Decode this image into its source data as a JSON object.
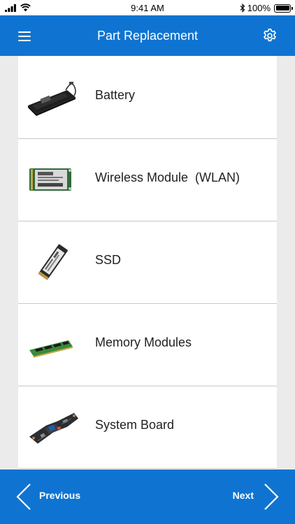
{
  "status_bar": {
    "time": "9:41 AM",
    "battery": "100%"
  },
  "header": {
    "title": "Part Replacement"
  },
  "parts": [
    {
      "label": "Battery",
      "icon": "battery-part-icon"
    },
    {
      "label": "Wireless Module  (WLAN)",
      "icon": "wlan-card-icon"
    },
    {
      "label": "SSD",
      "icon": "ssd-icon"
    },
    {
      "label": "Memory Modules",
      "icon": "memory-module-icon"
    },
    {
      "label": "System Board",
      "icon": "system-board-icon"
    }
  ],
  "footer": {
    "previous_label": "Previous",
    "next_label": "Next"
  },
  "colors": {
    "primary": "#0f74d1",
    "background": "#ebebeb"
  }
}
